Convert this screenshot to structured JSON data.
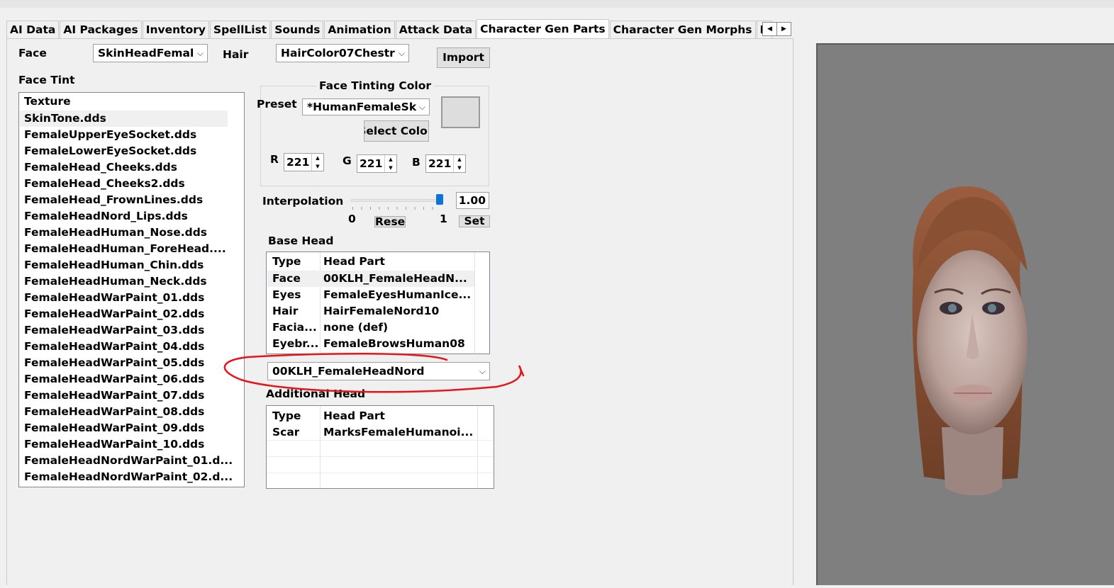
{
  "tabs": [
    "AI Data",
    "AI Packages",
    "Inventory",
    "SpellList",
    "Sounds",
    "Animation",
    "Attack Data",
    "Character Gen Parts",
    "Character Gen Morphs",
    "F"
  ],
  "active_tab": "Character Gen Parts",
  "face": {
    "label": "Face",
    "value": "SkinHeadFemal"
  },
  "hair": {
    "label": "Hair",
    "value": "HairColor07Chestr"
  },
  "import_button": "Import",
  "face_tint": {
    "label": "Face Tint",
    "header": "Texture",
    "items": [
      "SkinTone.dds",
      "FemaleUpperEyeSocket.dds",
      "FemaleLowerEyeSocket.dds",
      "FemaleHead_Cheeks.dds",
      "FemaleHead_Cheeks2.dds",
      "FemaleHead_FrownLines.dds",
      "FemaleHeadNord_Lips.dds",
      "FemaleHeadHuman_Nose.dds",
      "FemaleHeadHuman_ForeHead....",
      "FemaleHeadHuman_Chin.dds",
      "FemaleHeadHuman_Neck.dds",
      "FemaleHeadWarPaint_01.dds",
      "FemaleHeadWarPaint_02.dds",
      "FemaleHeadWarPaint_03.dds",
      "FemaleHeadWarPaint_04.dds",
      "FemaleHeadWarPaint_05.dds",
      "FemaleHeadWarPaint_06.dds",
      "FemaleHeadWarPaint_07.dds",
      "FemaleHeadWarPaint_08.dds",
      "FemaleHeadWarPaint_09.dds",
      "FemaleHeadWarPaint_10.dds",
      "FemaleHeadNordWarPaint_01.d...",
      "FemaleHeadNordWarPaint_02.d..."
    ]
  },
  "tinting": {
    "title": "Face Tinting Color",
    "preset_label": "Preset",
    "preset_value": "*HumanFemaleSk",
    "select_color_button": "Select Colo",
    "r_label": "R",
    "r_value": "221",
    "g_label": "G",
    "g_value": "221",
    "b_label": "B",
    "b_value": "221",
    "swatch_color": "#dddddd"
  },
  "interpolation": {
    "label": "Interpolation",
    "value": "1.00",
    "min": "0",
    "max": "1",
    "level": 1.0,
    "reset_button": "Reset",
    "set_button": "Set"
  },
  "base_head": {
    "label": "Base Head",
    "columns": [
      "Type",
      "Head Part"
    ],
    "rows": [
      [
        "Face",
        "00KLH_FemaleHeadN..."
      ],
      [
        "Eyes",
        "FemaleEyesHumanIce..."
      ],
      [
        "Hair",
        "HairFemaleNord10"
      ],
      [
        "Facia...",
        "none (def)"
      ],
      [
        "Eyebr...",
        "FemaleBrowsHuman08"
      ]
    ],
    "dropdown_value": "00KLH_FemaleHeadNord"
  },
  "additional_head": {
    "label": "Additional Head",
    "columns": [
      "Type",
      "Head Part"
    ],
    "rows": [
      [
        "Scar",
        "MarksFemaleHumanoi..."
      ]
    ]
  },
  "colors": {
    "annotation_red": "#e8141a",
    "slider_thumb": "#0a74d8",
    "viewport_bg": "#7f7f7f"
  }
}
